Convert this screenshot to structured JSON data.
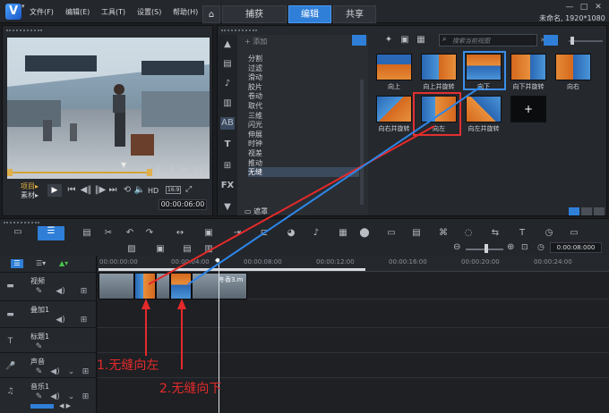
{
  "app": {
    "menus": [
      "文件(F)",
      "编辑(E)",
      "工具(T)",
      "设置(S)",
      "帮助(H)"
    ],
    "tabs": [
      "捕获",
      "编辑",
      "共享"
    ],
    "project_info": "未命名, 1920*1080"
  },
  "player": {
    "mode_project": "项目▸",
    "mode_clip": "素材▸",
    "hd": "HD",
    "ratio": "16:9",
    "timecode": "00:00:06:00"
  },
  "library": {
    "add_label": "添加",
    "categories": [
      "分割",
      "过滤",
      "滑动",
      "胶片",
      "卷动",
      "取代",
      "三维",
      "闪光",
      "伸展",
      "时钟",
      "视差",
      "推动",
      "无缝",
      "遮罩"
    ],
    "selected_category": "无缝",
    "search_placeholder": "搜索当前视图",
    "transitions": [
      "向上",
      "向上并旋转",
      "向下",
      "向下并旋转",
      "向右",
      "向右并旋转",
      "向左",
      "向左并旋转"
    ],
    "selected_transition": "向下",
    "highlighted_transition": "向左",
    "empty_slot": "+"
  },
  "timeline": {
    "ruler": [
      "00:00:00:00",
      "00:00:04:00",
      "00:00:08:00",
      "00:00:12:00",
      "00:00:16:00",
      "00:00:20:00",
      "00:00:24:00"
    ],
    "zoom_timecode": "0:00:08:000",
    "tracks": [
      "视频",
      "叠加1",
      "标题1",
      "声音",
      "音乐1"
    ],
    "clip_label": "冬香3.m"
  },
  "annotations": {
    "label_1": "1.无缝向左",
    "label_2": "2.无缝向下"
  },
  "colors": {
    "accent": "#2f7fd8",
    "annotation_red": "#e52a2a",
    "annotation_blue": "#2e86e8"
  }
}
